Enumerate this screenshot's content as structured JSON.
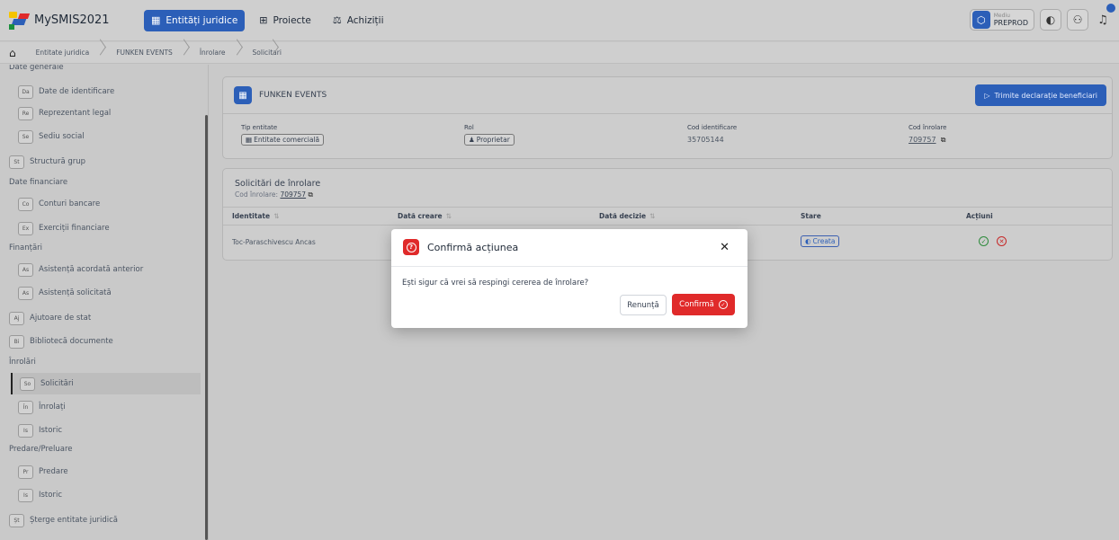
{
  "app": {
    "name": "MySMIS2021"
  },
  "nav": [
    {
      "label": "Entități juridice",
      "icon": "building-icon",
      "active": true
    },
    {
      "label": "Proiecte",
      "icon": "hierarchy-icon",
      "active": false
    },
    {
      "label": "Achiziții",
      "icon": "scale-icon",
      "active": false
    }
  ],
  "env": {
    "label": "Mediu",
    "value": "PREPROD"
  },
  "breadcrumb": [
    "Entitate juridica",
    "FUNKEN EVENTS",
    "Înrolare",
    "Solicitari"
  ],
  "sidebar": {
    "top_group": "Date generale",
    "items_general": [
      {
        "badge": "Da",
        "label": "Date de identificare"
      },
      {
        "badge": "Re",
        "label": "Reprezentant legal"
      },
      {
        "badge": "Se",
        "label": "Sediu social"
      }
    ],
    "structura": {
      "badge": "St",
      "label": "Structură grup"
    },
    "group_financiare": "Date financiare",
    "items_financiare": [
      {
        "badge": "Co",
        "label": "Conturi bancare"
      },
      {
        "badge": "Ex",
        "label": "Exerciții financiare"
      }
    ],
    "group_finantari": "Finanțări",
    "items_finantari": [
      {
        "badge": "As",
        "label": "Asistență acordată anterior"
      },
      {
        "badge": "As",
        "label": "Asistență solicitată"
      }
    ],
    "ajutoare": {
      "badge": "Aj",
      "label": "Ajutoare de stat"
    },
    "biblioteca": {
      "badge": "Bi",
      "label": "Bibliotecă documente"
    },
    "group_inrolari": "Înrolări",
    "items_inrolari": [
      {
        "badge": "So",
        "label": "Solicitări"
      },
      {
        "badge": "În",
        "label": "Înrolați"
      },
      {
        "badge": "Is",
        "label": "Istoric"
      }
    ],
    "group_predare": "Predare/Preluare",
    "items_predare": [
      {
        "badge": "Pr",
        "label": "Predare"
      },
      {
        "badge": "Is",
        "label": "Istoric"
      }
    ],
    "sterge": {
      "badge": "Șt",
      "label": "Șterge entitate juridică"
    }
  },
  "entity": {
    "name": "FUNKEN EVENTS",
    "action_label": "Trimite declarație beneficiari",
    "fields": [
      {
        "label": "Tip entitate",
        "value": "Entitate comercială",
        "kind": "chip",
        "icon": "building-icon"
      },
      {
        "label": "Rol",
        "value": "Proprietar",
        "kind": "chip",
        "icon": "user-icon"
      },
      {
        "label": "Cod identificare",
        "value": "35705144",
        "kind": "text"
      },
      {
        "label": "Cod înrolare",
        "value": "709757",
        "kind": "link"
      }
    ]
  },
  "solicitari": {
    "title": "Solicitări de înrolare",
    "code_label": "Cod înrolare:",
    "code_value": "709757",
    "columns": [
      "Identitate",
      "Dată creare",
      "Dată decizie",
      "Stare",
      "Acțiuni"
    ],
    "rows": [
      {
        "identitate": "Toc-Paraschivescu Ancas",
        "data_creare": "",
        "data_decizie": "",
        "stare": "Creata"
      }
    ]
  },
  "modal": {
    "title": "Confirmă acțiunea",
    "message": "Ești sigur că vrei să respingi cererea de înrolare?",
    "cancel_label": "Renunță",
    "confirm_label": "Confirmă"
  },
  "colors": {
    "primary": "#2c5fb8",
    "danger": "#e02a2a",
    "success": "#2e8b3c"
  }
}
